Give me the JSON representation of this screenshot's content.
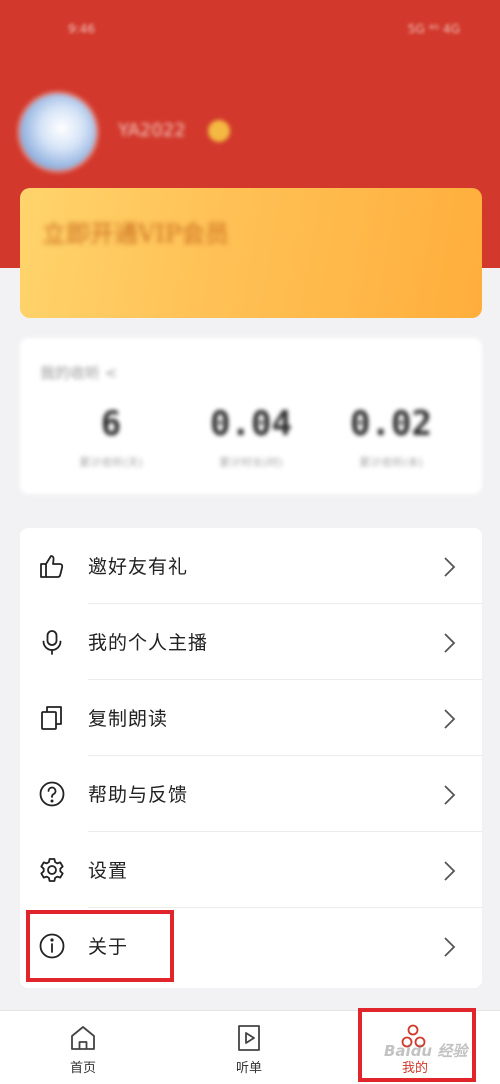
{
  "status_bar": {
    "time": "9:46",
    "indicators": "5G ⁴ᴳ 4G"
  },
  "profile": {
    "username": "YA2022",
    "avatar_icon": "avatar-image",
    "badge_icon": "crown-icon"
  },
  "vip": {
    "label": "立即开通VIP会员"
  },
  "stats": {
    "title": "我的收听 <",
    "items": [
      {
        "value": "6",
        "label": "累计收听(天)"
      },
      {
        "value": "0.04",
        "label": "累计时长(时)"
      },
      {
        "value": "0.02",
        "label": "累计收听(本)"
      }
    ]
  },
  "menu": {
    "items": [
      {
        "label": "邀好友有礼",
        "icon": "thumbs-up-icon"
      },
      {
        "label": "我的个人主播",
        "icon": "microphone-icon"
      },
      {
        "label": "复制朗读",
        "icon": "copy-icon"
      },
      {
        "label": "帮助与反馈",
        "icon": "help-icon"
      },
      {
        "label": "设置",
        "icon": "gear-icon"
      },
      {
        "label": "关于",
        "icon": "info-icon"
      }
    ]
  },
  "bottom_nav": {
    "items": [
      {
        "label": "首页",
        "icon": "home-icon",
        "active": false
      },
      {
        "label": "听单",
        "icon": "playlist-icon",
        "active": false
      },
      {
        "label": "我的",
        "icon": "user-group-icon",
        "active": true
      }
    ]
  },
  "watermark": "Baidu 经验",
  "colors": {
    "header_red": "#d2392c",
    "vip_gold": "#ffc257",
    "highlight_red": "#e0262b"
  }
}
